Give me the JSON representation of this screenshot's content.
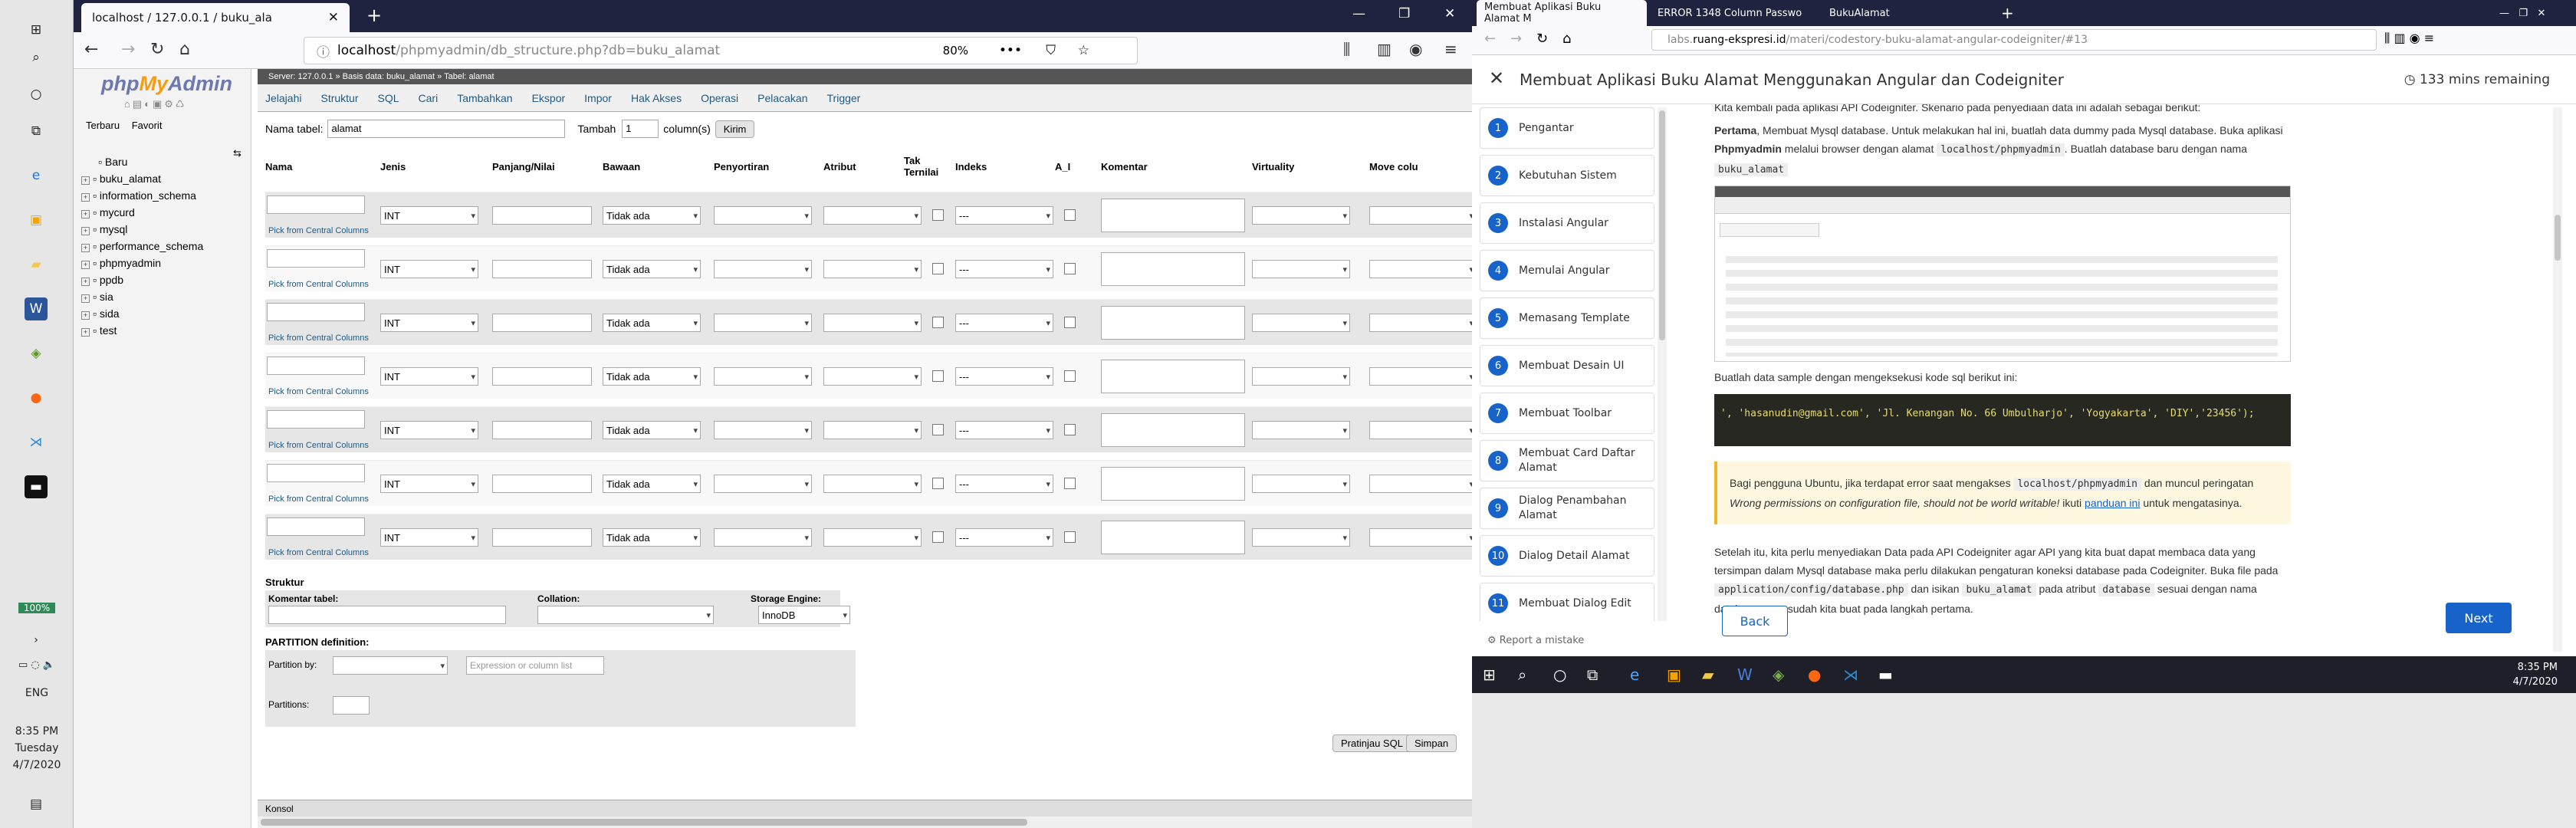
{
  "taskbar_left": {
    "battery": "100%",
    "lang": "ENG",
    "time": "8:35 PM",
    "day": "Tuesday",
    "date": "4/7/2020"
  },
  "left_browser": {
    "tab_title": "localhost / 127.0.0.1 / buku_ala",
    "url_prefix": "localhost",
    "url_path": "/phpmyadmin/db_structure.php?db=buku_alamat",
    "zoom": "80%",
    "pma": {
      "logo_php": "php",
      "logo_my": "My",
      "logo_admin": "Admin",
      "side_tabs": [
        "Terbaru",
        "Favorit"
      ],
      "tree": [
        "Baru",
        "buku_alamat",
        "information_schema",
        "mycurd",
        "mysql",
        "performance_schema",
        "phpmyadmin",
        "ppdb",
        "sia",
        "sida",
        "test"
      ],
      "breadcrumb": "Server: 127.0.0.1 » Basis data: buku_alamat » Tabel: alamat",
      "menu": [
        "Jelajahi",
        "Struktur",
        "SQL",
        "Cari",
        "Tambahkan",
        "Ekspor",
        "Impor",
        "Hak Akses",
        "Operasi",
        "Pelacakan",
        "Trigger"
      ],
      "table_name_label": "Nama tabel:",
      "table_name_value": "alamat",
      "add_label": "Tambah",
      "add_count": "1",
      "columns_label": "column(s)",
      "go_label": "Kirim",
      "headers": {
        "nama": "Nama",
        "jenis": "Jenis",
        "panjang": "Panjang/Nilai",
        "bawaan": "Bawaan",
        "penyortiran": "Penyortiran",
        "atribut": "Atribut",
        "tak": "Tak Ternilai",
        "indeks": "Indeks",
        "ai": "A_I",
        "komentar": "Komentar",
        "virtuality": "Virtuality",
        "move": "Move colu"
      },
      "row": {
        "type": "INT",
        "default": "Tidak ada",
        "index": "---",
        "pick": "Pick from Central Columns"
      },
      "struktur_label": "Struktur",
      "komentar_tabel": "Komentar tabel:",
      "collation": "Collation:",
      "storage": "Storage Engine:",
      "engine": "InnoDB",
      "partition": "PARTITION definition:",
      "partition_by": "Partition by:",
      "expr_placeholder": "Expression or column list",
      "partitions": "Partitions:",
      "preview_btn": "Pratinjau SQL",
      "save_btn": "Simpan",
      "konsol": "Konsol"
    }
  },
  "right_browser": {
    "tabs": [
      "Membuat Aplikasi Buku Alamat M",
      "ERROR 1348 Column Passwo",
      "BukuAlamat"
    ],
    "url_gray": "labs.",
    "url_host": "ruang-ekspresi.id",
    "url_path": "/materi/codestory-buku-alamat-angular-codeigniter/#13",
    "course_title": "Membuat Aplikasi Buku Alamat Menggunakan Angular dan Codeigniter",
    "remaining": "133 mins remaining",
    "steps": [
      {
        "n": "1",
        "t": "Pengantar"
      },
      {
        "n": "2",
        "t": "Kebutuhan Sistem"
      },
      {
        "n": "3",
        "t": "Instalasi Angular"
      },
      {
        "n": "4",
        "t": "Memulai Angular"
      },
      {
        "n": "5",
        "t": "Memasang Template"
      },
      {
        "n": "6",
        "t": "Membuat Desain UI"
      },
      {
        "n": "7",
        "t": "Membuat Toolbar"
      },
      {
        "n": "8",
        "t": "Membuat Card Daftar Alamat"
      },
      {
        "n": "9",
        "t": "Dialog Penambahan Alamat"
      },
      {
        "n": "10",
        "t": "Dialog Detail Alamat"
      },
      {
        "n": "11",
        "t": "Membuat Dialog Edit"
      }
    ],
    "report": "Report a mistake",
    "content": {
      "top_line": "Kita kembali pada aplikasi API Codeigniter. Skenario pada penyediaan data ini adalah sebagai berikut:",
      "p1_bold": "Pertama",
      "p1_a": ", Membuat Mysql database. Untuk melakukan hal ini, buatlah data dummy pada Mysql database. Buka aplikasi ",
      "p1_b": "Phpmyadmin",
      "p1_c": " melalui browser dengan alamat ",
      "p1_code": "localhost/phpmyadmin",
      "p1_d": ". Buatlah database baru dengan nama ",
      "p1_code2": "buku_alamat",
      "p2": "Buatlah data sample dengan mengeksekusi kode sql berikut ini:",
      "code": "', 'hasanudin@gmail.com', 'Jl. Kenangan No. 66 Umbulharjo', 'Yogyakarta', 'DIY','23456');",
      "note_a": "Bagi pengguna Ubuntu, jika terdapat error saat mengakses ",
      "note_code": "localhost/phpmyadmin",
      "note_b": " dan muncul peringatan ",
      "note_c": "Wrong permissions on configuration file, should not be world writable!",
      "note_d": " ikuti ",
      "note_link": "panduan ini",
      "note_e": " untuk mengatasinya.",
      "p3_a": "Setelah itu, kita perlu menyediakan Data pada API Codeigniter agar API yang kita buat dapat membaca data yang tersimpan dalam Mysql database maka perlu dilakukan pengaturan koneksi database pada Codeigniter. Buka file pada ",
      "p3_code": "application/config/database.php",
      "p3_b": " dan isikan ",
      "p3_code2": "buku_alamat",
      "p3_c": " pada atribut ",
      "p3_code3": "database",
      "p3_d": " sesuai dengan nama database yang sudah kita buat pada langkah pertama."
    },
    "back": "Back",
    "next": "Next",
    "time": "8:35 PM",
    "date": "4/7/2020"
  }
}
